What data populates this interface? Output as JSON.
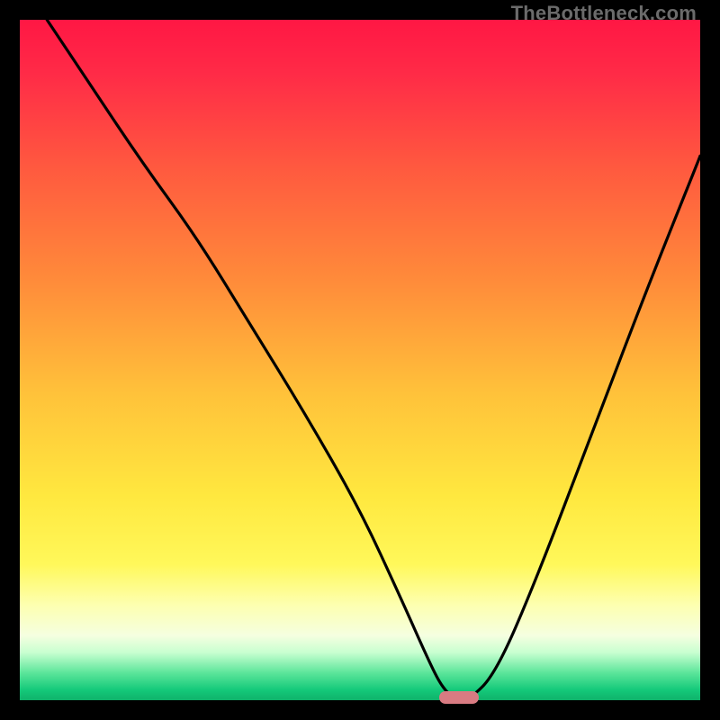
{
  "watermark": "TheBottleneck.com",
  "chart_data": {
    "type": "line",
    "title": "",
    "xlabel": "",
    "ylabel": "",
    "xlim": [
      0,
      100
    ],
    "ylim": [
      0,
      100
    ],
    "grid": false,
    "series": [
      {
        "name": "curve",
        "x": [
          4,
          10,
          18,
          26,
          34,
          42,
          50,
          56,
          60,
          62,
          64,
          66,
          70,
          76,
          84,
          92,
          100
        ],
        "y": [
          100,
          91,
          79,
          68,
          55,
          42,
          28,
          15,
          6,
          2,
          0,
          0,
          4,
          18,
          39,
          60,
          80
        ]
      }
    ],
    "marker": {
      "x": 64.5,
      "y": 0
    },
    "gradient_stops": [
      {
        "offset": 0.0,
        "color": "#ff1744"
      },
      {
        "offset": 0.08,
        "color": "#ff2b47"
      },
      {
        "offset": 0.22,
        "color": "#ff5a3f"
      },
      {
        "offset": 0.38,
        "color": "#ff8a3a"
      },
      {
        "offset": 0.55,
        "color": "#ffc23a"
      },
      {
        "offset": 0.7,
        "color": "#ffe83f"
      },
      {
        "offset": 0.8,
        "color": "#fff85a"
      },
      {
        "offset": 0.86,
        "color": "#fdffb0"
      },
      {
        "offset": 0.905,
        "color": "#f5ffe0"
      },
      {
        "offset": 0.93,
        "color": "#c8ffd0"
      },
      {
        "offset": 0.96,
        "color": "#5be59a"
      },
      {
        "offset": 0.985,
        "color": "#14c97a"
      },
      {
        "offset": 1.0,
        "color": "#0fb26a"
      }
    ]
  }
}
